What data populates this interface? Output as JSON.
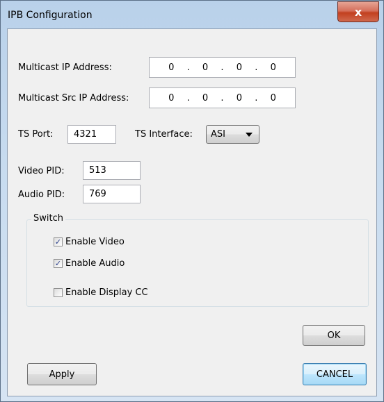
{
  "window": {
    "title": "IPB Configuration",
    "close_glyph": "x"
  },
  "multicast_ip": {
    "label": "Multicast IP Address:",
    "octets": [
      "0",
      "0",
      "0",
      "0"
    ]
  },
  "multicast_src_ip": {
    "label": "Multicast Src IP Address:",
    "octets": [
      "0",
      "0",
      "0",
      "0"
    ]
  },
  "ts_port": {
    "label": "TS Port:",
    "value": "4321"
  },
  "ts_interface": {
    "label": "TS Interface:",
    "value": "ASI"
  },
  "video_pid": {
    "label": "Video PID:",
    "value": "513"
  },
  "audio_pid": {
    "label": "Audio PID:",
    "value": "769"
  },
  "switch_group": {
    "title": "Switch",
    "enable_video": {
      "label": "Enable Video",
      "checked": true
    },
    "enable_audio": {
      "label": "Enable Audio",
      "checked": true
    },
    "enable_display_cc": {
      "label": "Enable Display CC",
      "checked": false
    }
  },
  "buttons": {
    "ok": "OK",
    "apply": "Apply",
    "cancel": "CANCEL"
  },
  "icons": {
    "check": "✓"
  }
}
